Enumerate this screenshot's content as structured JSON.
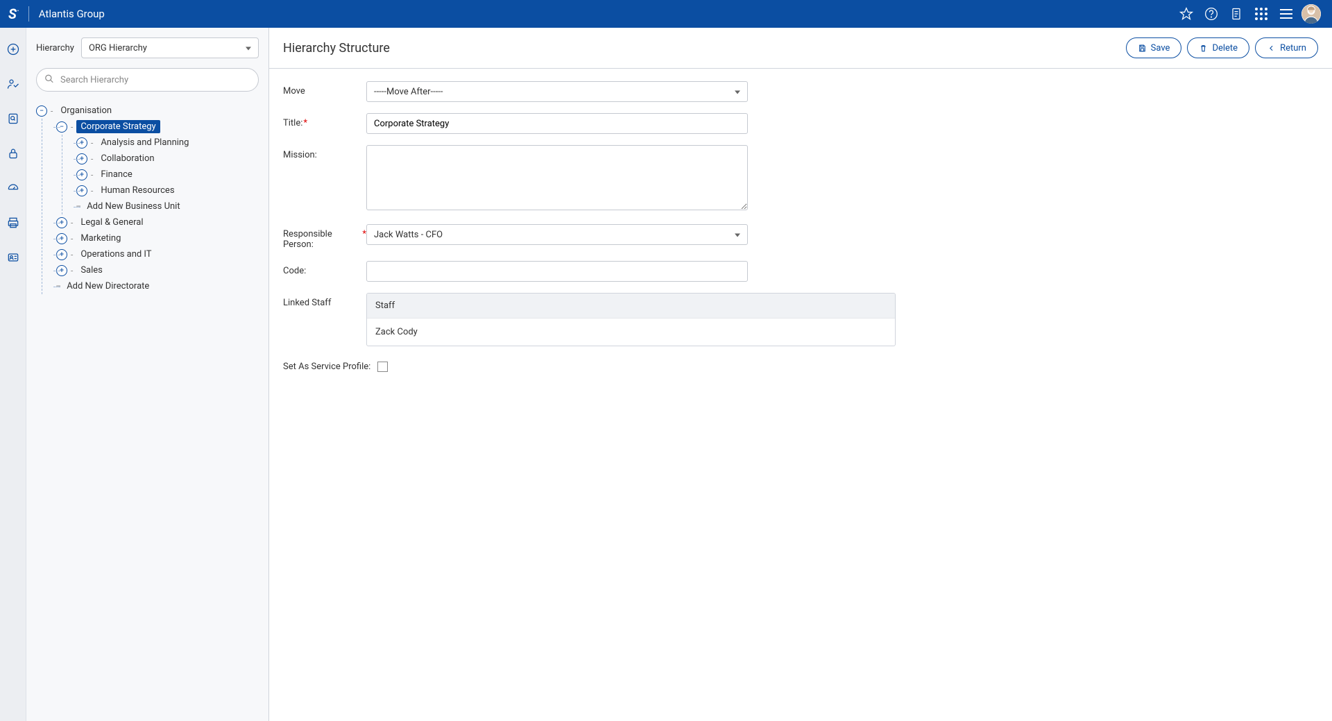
{
  "header": {
    "logo": "S",
    "title": "Atlantis Group"
  },
  "leftPanel": {
    "hierLabel": "Hierarchy",
    "hierSelect": "ORG Hierarchy",
    "searchPlaceholder": "Search Hierarchy",
    "tree": {
      "root": "Organisation",
      "corpStrategy": "Corporate Strategy",
      "children": {
        "analysis": "Analysis and Planning",
        "collab": "Collaboration",
        "finance": "Finance",
        "hr": "Human Resources",
        "addBU": "Add New Business Unit"
      },
      "legal": "Legal & General",
      "marketing": "Marketing",
      "opsIT": "Operations and IT",
      "sales": "Sales",
      "addDir": "Add New Directorate"
    }
  },
  "main": {
    "title": "Hierarchy Structure",
    "buttons": {
      "save": "Save",
      "delete": "Delete",
      "return": "Return"
    },
    "form": {
      "moveLabel": "Move",
      "moveValue": "-----Move After-----",
      "titleLabel": "Title:",
      "titleValue": "Corporate Strategy",
      "missionLabel": "Mission:",
      "missionValue": "",
      "respLabel": "Responsible Person:",
      "respValue": "Jack Watts - CFO",
      "codeLabel": "Code:",
      "codeValue": "",
      "linkedLabel": "Linked Staff",
      "staffHeader": "Staff",
      "staffRows": [
        "Zack Cody"
      ],
      "serviceProfileLabel": "Set As Service Profile:"
    }
  }
}
